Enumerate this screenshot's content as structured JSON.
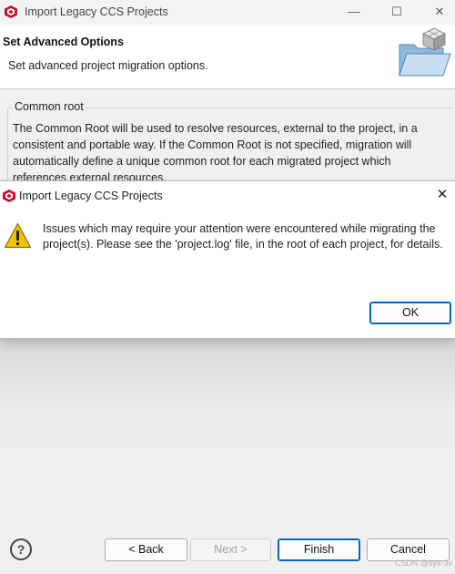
{
  "window": {
    "title": "Import Legacy CCS Projects",
    "controls": {
      "minimize": "—",
      "maximize": "☐",
      "close": "✕"
    }
  },
  "banner": {
    "heading": "Set Advanced Options",
    "description": "Set advanced project migration options."
  },
  "common_root": {
    "legend": "Common root",
    "text": "The Common Root will be used to resolve resources, external to the project, in a consistent and portable way. If the Common Root is not specified, migration will automatically define a unique common root for each migrated project which references external resources."
  },
  "dialog": {
    "title": "Import Legacy CCS Projects",
    "close": "✕",
    "message": "Issues which may require your attention were encountered while migrating the project(s). Please see the 'project.log' file, in the root of each project, for details.",
    "ok_label": "OK",
    "icon": "warning-icon"
  },
  "footer": {
    "help": "?",
    "back_label": "< Back",
    "next_label": "Next >",
    "finish_label": "Finish",
    "cancel_label": "Cancel",
    "watermark": "CSDN @syx-3v"
  },
  "colors": {
    "accent": "#0067c0",
    "app_icon": "#c8102e",
    "warning": "#f2c200"
  }
}
